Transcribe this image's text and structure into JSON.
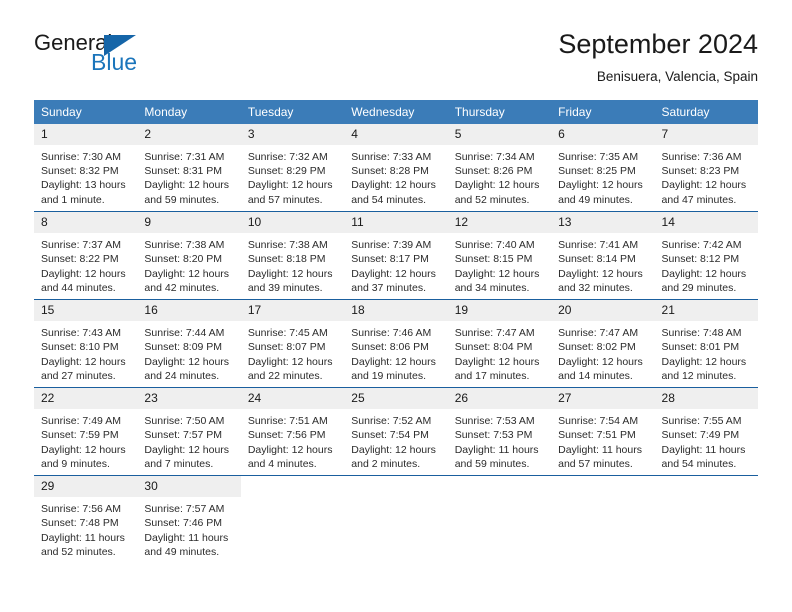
{
  "logo": {
    "word_one": "General",
    "word_two": "Blue",
    "triangle_icon": "triangle-icon",
    "accent_color": "#1b75bb"
  },
  "header": {
    "month_title": "September 2024",
    "location": "Benisuera, Valencia, Spain"
  },
  "calendar": {
    "header_bg": "#3b7cb8",
    "daynum_bg": "#efefef",
    "weekdays": [
      "Sunday",
      "Monday",
      "Tuesday",
      "Wednesday",
      "Thursday",
      "Friday",
      "Saturday"
    ],
    "weeks": [
      [
        {
          "day": "1",
          "sunrise": "Sunrise: 7:30 AM",
          "sunset": "Sunset: 8:32 PM",
          "daylight_line1": "Daylight: 13 hours",
          "daylight_line2": "and 1 minute."
        },
        {
          "day": "2",
          "sunrise": "Sunrise: 7:31 AM",
          "sunset": "Sunset: 8:31 PM",
          "daylight_line1": "Daylight: 12 hours",
          "daylight_line2": "and 59 minutes."
        },
        {
          "day": "3",
          "sunrise": "Sunrise: 7:32 AM",
          "sunset": "Sunset: 8:29 PM",
          "daylight_line1": "Daylight: 12 hours",
          "daylight_line2": "and 57 minutes."
        },
        {
          "day": "4",
          "sunrise": "Sunrise: 7:33 AM",
          "sunset": "Sunset: 8:28 PM",
          "daylight_line1": "Daylight: 12 hours",
          "daylight_line2": "and 54 minutes."
        },
        {
          "day": "5",
          "sunrise": "Sunrise: 7:34 AM",
          "sunset": "Sunset: 8:26 PM",
          "daylight_line1": "Daylight: 12 hours",
          "daylight_line2": "and 52 minutes."
        },
        {
          "day": "6",
          "sunrise": "Sunrise: 7:35 AM",
          "sunset": "Sunset: 8:25 PM",
          "daylight_line1": "Daylight: 12 hours",
          "daylight_line2": "and 49 minutes."
        },
        {
          "day": "7",
          "sunrise": "Sunrise: 7:36 AM",
          "sunset": "Sunset: 8:23 PM",
          "daylight_line1": "Daylight: 12 hours",
          "daylight_line2": "and 47 minutes."
        }
      ],
      [
        {
          "day": "8",
          "sunrise": "Sunrise: 7:37 AM",
          "sunset": "Sunset: 8:22 PM",
          "daylight_line1": "Daylight: 12 hours",
          "daylight_line2": "and 44 minutes."
        },
        {
          "day": "9",
          "sunrise": "Sunrise: 7:38 AM",
          "sunset": "Sunset: 8:20 PM",
          "daylight_line1": "Daylight: 12 hours",
          "daylight_line2": "and 42 minutes."
        },
        {
          "day": "10",
          "sunrise": "Sunrise: 7:38 AM",
          "sunset": "Sunset: 8:18 PM",
          "daylight_line1": "Daylight: 12 hours",
          "daylight_line2": "and 39 minutes."
        },
        {
          "day": "11",
          "sunrise": "Sunrise: 7:39 AM",
          "sunset": "Sunset: 8:17 PM",
          "daylight_line1": "Daylight: 12 hours",
          "daylight_line2": "and 37 minutes."
        },
        {
          "day": "12",
          "sunrise": "Sunrise: 7:40 AM",
          "sunset": "Sunset: 8:15 PM",
          "daylight_line1": "Daylight: 12 hours",
          "daylight_line2": "and 34 minutes."
        },
        {
          "day": "13",
          "sunrise": "Sunrise: 7:41 AM",
          "sunset": "Sunset: 8:14 PM",
          "daylight_line1": "Daylight: 12 hours",
          "daylight_line2": "and 32 minutes."
        },
        {
          "day": "14",
          "sunrise": "Sunrise: 7:42 AM",
          "sunset": "Sunset: 8:12 PM",
          "daylight_line1": "Daylight: 12 hours",
          "daylight_line2": "and 29 minutes."
        }
      ],
      [
        {
          "day": "15",
          "sunrise": "Sunrise: 7:43 AM",
          "sunset": "Sunset: 8:10 PM",
          "daylight_line1": "Daylight: 12 hours",
          "daylight_line2": "and 27 minutes."
        },
        {
          "day": "16",
          "sunrise": "Sunrise: 7:44 AM",
          "sunset": "Sunset: 8:09 PM",
          "daylight_line1": "Daylight: 12 hours",
          "daylight_line2": "and 24 minutes."
        },
        {
          "day": "17",
          "sunrise": "Sunrise: 7:45 AM",
          "sunset": "Sunset: 8:07 PM",
          "daylight_line1": "Daylight: 12 hours",
          "daylight_line2": "and 22 minutes."
        },
        {
          "day": "18",
          "sunrise": "Sunrise: 7:46 AM",
          "sunset": "Sunset: 8:06 PM",
          "daylight_line1": "Daylight: 12 hours",
          "daylight_line2": "and 19 minutes."
        },
        {
          "day": "19",
          "sunrise": "Sunrise: 7:47 AM",
          "sunset": "Sunset: 8:04 PM",
          "daylight_line1": "Daylight: 12 hours",
          "daylight_line2": "and 17 minutes."
        },
        {
          "day": "20",
          "sunrise": "Sunrise: 7:47 AM",
          "sunset": "Sunset: 8:02 PM",
          "daylight_line1": "Daylight: 12 hours",
          "daylight_line2": "and 14 minutes."
        },
        {
          "day": "21",
          "sunrise": "Sunrise: 7:48 AM",
          "sunset": "Sunset: 8:01 PM",
          "daylight_line1": "Daylight: 12 hours",
          "daylight_line2": "and 12 minutes."
        }
      ],
      [
        {
          "day": "22",
          "sunrise": "Sunrise: 7:49 AM",
          "sunset": "Sunset: 7:59 PM",
          "daylight_line1": "Daylight: 12 hours",
          "daylight_line2": "and 9 minutes."
        },
        {
          "day": "23",
          "sunrise": "Sunrise: 7:50 AM",
          "sunset": "Sunset: 7:57 PM",
          "daylight_line1": "Daylight: 12 hours",
          "daylight_line2": "and 7 minutes."
        },
        {
          "day": "24",
          "sunrise": "Sunrise: 7:51 AM",
          "sunset": "Sunset: 7:56 PM",
          "daylight_line1": "Daylight: 12 hours",
          "daylight_line2": "and 4 minutes."
        },
        {
          "day": "25",
          "sunrise": "Sunrise: 7:52 AM",
          "sunset": "Sunset: 7:54 PM",
          "daylight_line1": "Daylight: 12 hours",
          "daylight_line2": "and 2 minutes."
        },
        {
          "day": "26",
          "sunrise": "Sunrise: 7:53 AM",
          "sunset": "Sunset: 7:53 PM",
          "daylight_line1": "Daylight: 11 hours",
          "daylight_line2": "and 59 minutes."
        },
        {
          "day": "27",
          "sunrise": "Sunrise: 7:54 AM",
          "sunset": "Sunset: 7:51 PM",
          "daylight_line1": "Daylight: 11 hours",
          "daylight_line2": "and 57 minutes."
        },
        {
          "day": "28",
          "sunrise": "Sunrise: 7:55 AM",
          "sunset": "Sunset: 7:49 PM",
          "daylight_line1": "Daylight: 11 hours",
          "daylight_line2": "and 54 minutes."
        }
      ],
      [
        {
          "day": "29",
          "sunrise": "Sunrise: 7:56 AM",
          "sunset": "Sunset: 7:48 PM",
          "daylight_line1": "Daylight: 11 hours",
          "daylight_line2": "and 52 minutes."
        },
        {
          "day": "30",
          "sunrise": "Sunrise: 7:57 AM",
          "sunset": "Sunset: 7:46 PM",
          "daylight_line1": "Daylight: 11 hours",
          "daylight_line2": "and 49 minutes."
        },
        {
          "day": "",
          "sunrise": "",
          "sunset": "",
          "daylight_line1": "",
          "daylight_line2": ""
        },
        {
          "day": "",
          "sunrise": "",
          "sunset": "",
          "daylight_line1": "",
          "daylight_line2": ""
        },
        {
          "day": "",
          "sunrise": "",
          "sunset": "",
          "daylight_line1": "",
          "daylight_line2": ""
        },
        {
          "day": "",
          "sunrise": "",
          "sunset": "",
          "daylight_line1": "",
          "daylight_line2": ""
        },
        {
          "day": "",
          "sunrise": "",
          "sunset": "",
          "daylight_line1": "",
          "daylight_line2": ""
        }
      ]
    ]
  }
}
